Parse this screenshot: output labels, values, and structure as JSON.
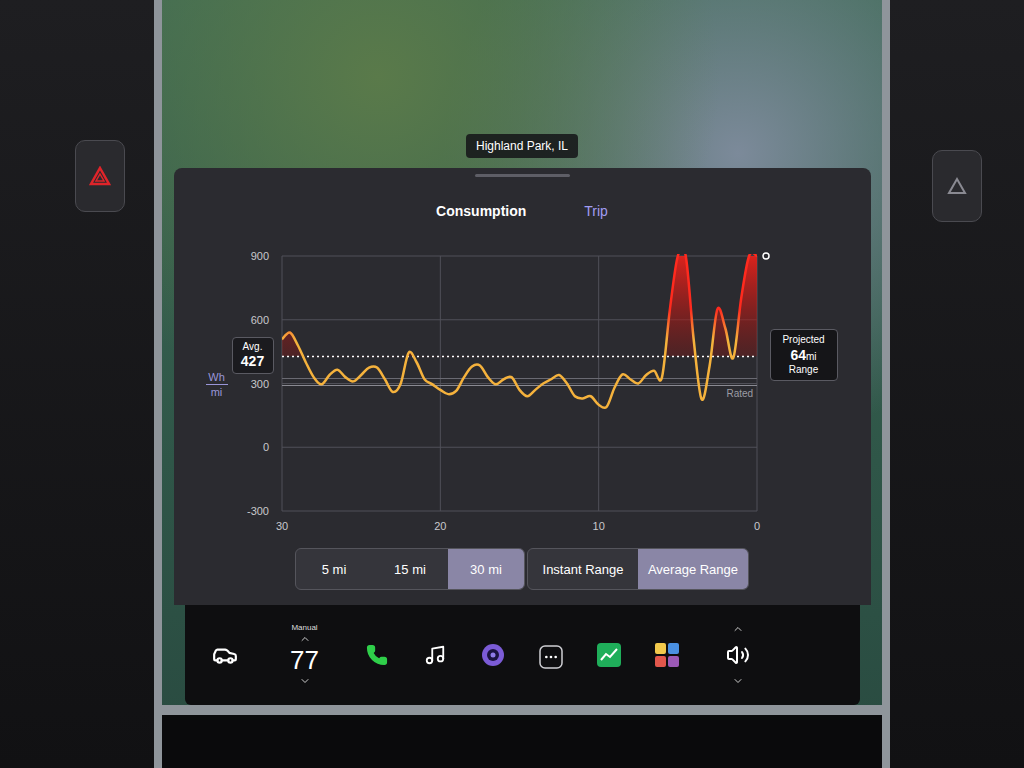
{
  "map": {
    "location_label": "Highland Park, IL"
  },
  "consumption_panel": {
    "tabs": [
      {
        "label": "Consumption",
        "selected": true
      },
      {
        "label": "Trip",
        "selected": false
      }
    ],
    "chart": {
      "y_axis": {
        "unit_top": "Wh",
        "unit_bottom": "mi",
        "ticks": [
          "900",
          "600",
          "300",
          "0",
          "-300"
        ]
      },
      "x_axis": {
        "ticks": [
          "30",
          "20",
          "10",
          "0"
        ]
      },
      "series": [
        {
          "name": "consumption",
          "color": "#f5b23c",
          "values": [
            508,
            540,
            480,
            400,
            330,
            296,
            340,
            365,
            330,
            310,
            340,
            375,
            375,
            320,
            260,
            300,
            445,
            400,
            320,
            296,
            270,
            250,
            265,
            330,
            380,
            385,
            330,
            296,
            320,
            330,
            270,
            240,
            270,
            300,
            320,
            340,
            300,
            240,
            230,
            240,
            200,
            190,
            280,
            343,
            320,
            300,
            340,
            360,
            330,
            650,
            950,
            950,
            508,
            226,
            380,
            650,
            560,
            420,
            700,
            950,
            900
          ]
        }
      ],
      "average": {
        "label": "Avg.",
        "value": "427"
      },
      "rated": {
        "label": "Rated",
        "value": 300
      },
      "projected": {
        "label_top": "Projected",
        "value": "64",
        "unit": "mi",
        "label_bottom": "Range"
      }
    },
    "distance_options": [
      {
        "label": "5 mi",
        "selected": false
      },
      {
        "label": "15 mi",
        "selected": false
      },
      {
        "label": "30 mi",
        "selected": true
      }
    ],
    "range_modes": [
      {
        "label": "Instant Range",
        "selected": false
      },
      {
        "label": "Average Range",
        "selected": true
      }
    ]
  },
  "dock": {
    "climate": {
      "mode": "Manual",
      "temperature": "77"
    }
  }
}
